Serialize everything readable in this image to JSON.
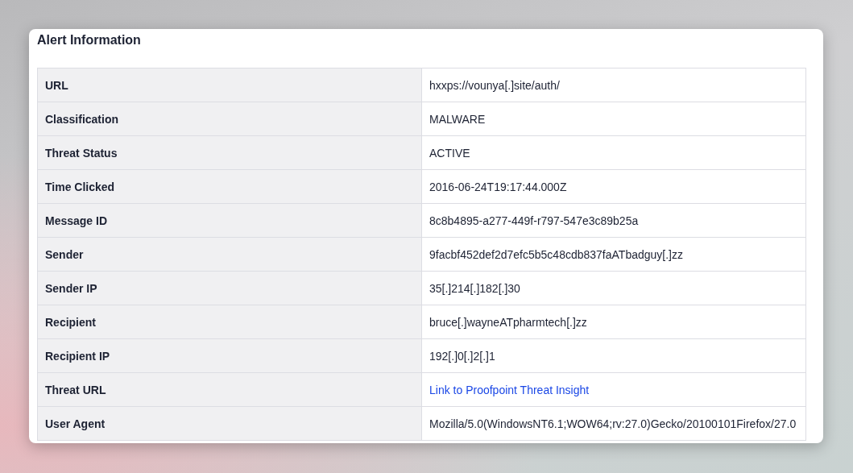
{
  "card": {
    "title": "Alert Information"
  },
  "rows": [
    {
      "label": "URL",
      "value": "hxxps://vounya[.]site/auth/",
      "kind": "text"
    },
    {
      "label": "Classification",
      "value": "MALWARE",
      "kind": "text"
    },
    {
      "label": "Threat Status",
      "value": "ACTIVE",
      "kind": "text"
    },
    {
      "label": "Time Clicked",
      "value": "2016-06-24T19:17:44.000Z",
      "kind": "text"
    },
    {
      "label": "Message ID",
      "value": "8c8b4895-a277-449f-r797-547e3c89b25a",
      "kind": "text"
    },
    {
      "label": "Sender",
      "value": "9facbf452def2d7efc5b5c48cdb837faATbadguy[.]zz",
      "kind": "text"
    },
    {
      "label": "Sender IP",
      "value": "35[.]214[.]182[.]30",
      "kind": "text"
    },
    {
      "label": "Recipient",
      "value": "bruce[.]wayneATpharmtech[.]zz",
      "kind": "text"
    },
    {
      "label": "Recipient IP",
      "value": "192[.]0[.]2[.]1",
      "kind": "text"
    },
    {
      "label": "Threat URL",
      "value": "Link to Proofpoint Threat Insight",
      "kind": "link"
    },
    {
      "label": "User Agent",
      "value": "Mozilla/5.0(WindowsNT6.1;WOW64;rv:27.0)Gecko/20100101Firefox/27.0",
      "kind": "text"
    }
  ]
}
